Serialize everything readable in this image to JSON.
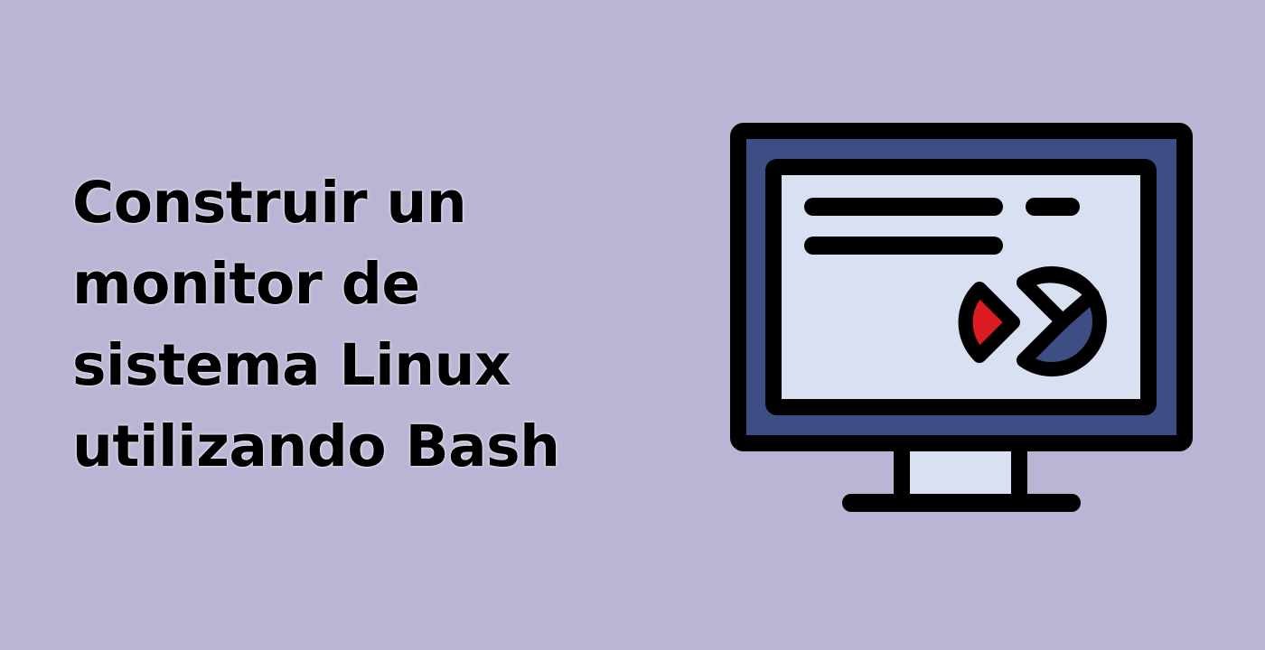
{
  "title_lines": [
    "Construir un",
    "monitor de",
    "sistema Linux",
    "utilizando Bash"
  ],
  "illustration": {
    "icon": "computer-monitor-icon",
    "chart_icon": "pie-chart-icon"
  },
  "colors": {
    "background": "#b9b5d4",
    "title_text": "#000000",
    "outline": "#000000",
    "bezel": "#3e4e85",
    "screen": "#d8e0f1",
    "slice_accent": "#dc1b22",
    "pie_fill": "#3e4e85"
  }
}
